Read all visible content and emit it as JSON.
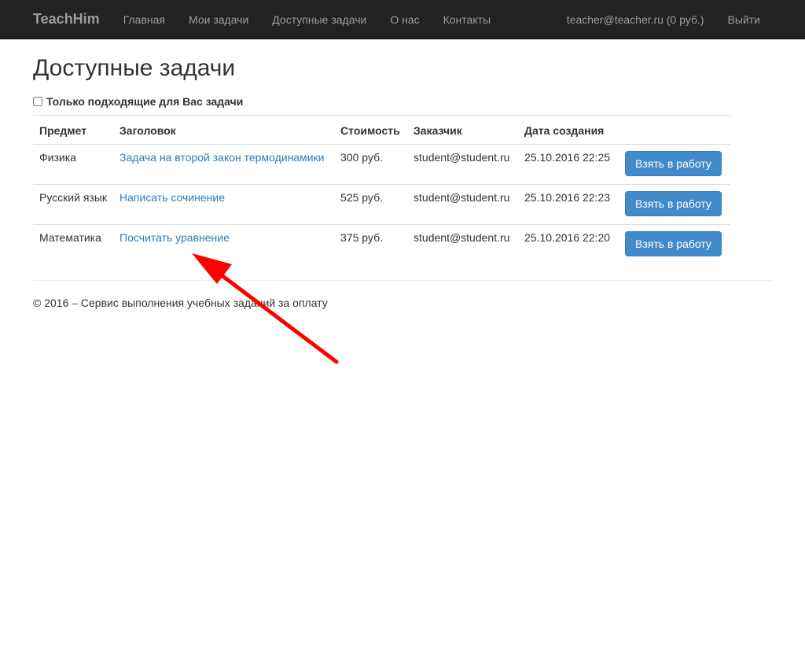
{
  "navbar": {
    "brand": "TeachHim",
    "links": [
      "Главная",
      "Мои задачи",
      "Доступные задачи",
      "О нас",
      "Контакты"
    ],
    "user": "teacher@teacher.ru (0 руб.)",
    "logout": "Выйти"
  },
  "page": {
    "title": "Доступные задачи",
    "filter_label": "Только подходящие для Вас задачи"
  },
  "table": {
    "headers": [
      "Предмет",
      "Заголовок",
      "Стоимость",
      "Заказчик",
      "Дата создания"
    ],
    "rows": [
      {
        "subject": "Физика",
        "title": "Задача на второй закон термодинамики",
        "price": "300 руб.",
        "customer": "student@student.ru",
        "date": "25.10.2016 22:25",
        "action": "Взять в работу"
      },
      {
        "subject": "Русский язык",
        "title": "Написать сочинение",
        "price": "525 руб.",
        "customer": "student@student.ru",
        "date": "25.10.2016 22:23",
        "action": "Взять в работу"
      },
      {
        "subject": "Математика",
        "title": "Посчитать уравнение",
        "price": "375 руб.",
        "customer": "student@student.ru",
        "date": "25.10.2016 22:20",
        "action": "Взять в работу"
      }
    ]
  },
  "footer": {
    "text": "© 2016 – Сервис выполнения учебных заданий за оплату"
  },
  "colors": {
    "navbar_bg": "#222222",
    "link": "#337ab7",
    "button": "#428bca",
    "arrow": "#ff0000"
  }
}
